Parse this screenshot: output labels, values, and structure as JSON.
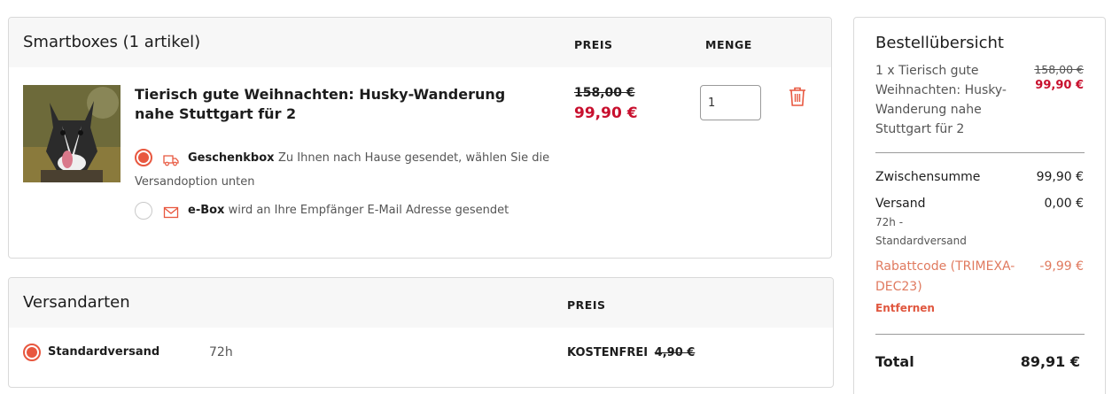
{
  "cart": {
    "title": "Smartboxes (1 artikel)",
    "col_price": "PREIS",
    "col_qty": "MENGE",
    "item": {
      "name": "Tierisch gute Weihnachten: Husky-Wanderung nahe Stuttgart für 2",
      "old_price": "158,00 €",
      "new_price": "99,90 €",
      "quantity": "1"
    },
    "options": [
      {
        "label": "Geschenkbox",
        "desc": "Zu Ihnen nach Hause gesendet, wählen Sie die Versandoption unten",
        "selected": true,
        "icon": "truck-icon"
      },
      {
        "label": "e-Box",
        "desc": "wird an Ihre Empfänger E-Mail Adresse gesendet",
        "selected": false,
        "icon": "envelope-icon"
      }
    ]
  },
  "shipping": {
    "title": "Versandarten",
    "col_price": "PREIS",
    "option": {
      "name": "Standardversand",
      "time": "72h",
      "price": "KOSTENFREI",
      "old_price": "4,90 €",
      "selected": true
    }
  },
  "summary": {
    "title": "Bestellübersicht",
    "item_desc": "1 x Tierisch gute Weihnachten: Husky-Wanderung nahe Stuttgart für 2",
    "item_old_price": "158,00 €",
    "item_new_price": "99,90 €",
    "subtotal_label": "Zwischensumme",
    "subtotal_value": "99,90 €",
    "shipping_label": "Versand",
    "shipping_value": "0,00 €",
    "shipping_detail_1": "72h -",
    "shipping_detail_2": "Standardversand",
    "discount_label_1": "Rabattcode (TRIMEXA-",
    "discount_label_2": "DEC23)",
    "discount_value": "-9,99 €",
    "remove_label": "Entfernen",
    "total_label": "Total",
    "total_value": "89,91 €"
  },
  "colors": {
    "accent": "#e8573f",
    "price_red": "#c8102e",
    "discount": "#e07a5f"
  }
}
